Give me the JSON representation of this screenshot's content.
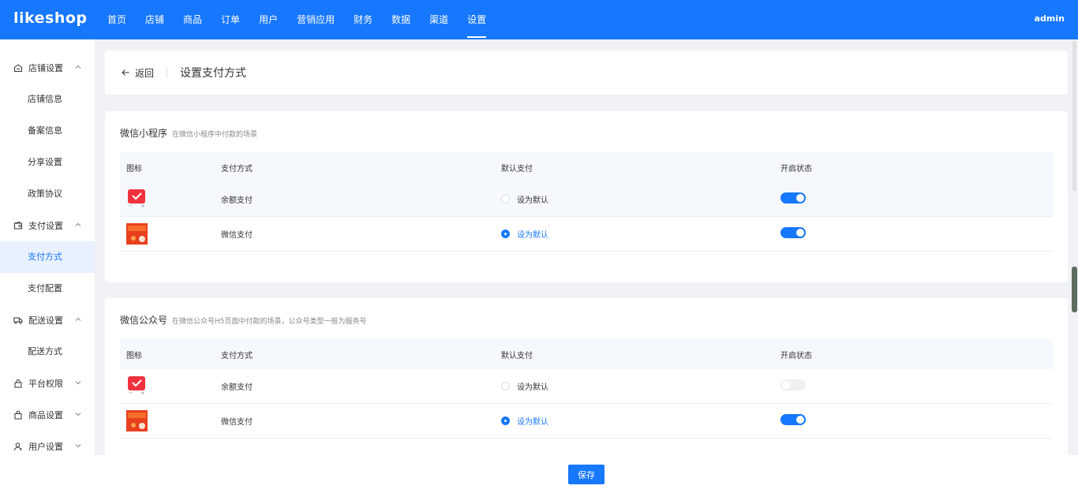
{
  "header": {
    "logo": "likeshop",
    "nav": [
      "首页",
      "店铺",
      "商品",
      "订单",
      "用户",
      "营销应用",
      "财务",
      "数据",
      "渠道",
      "设置"
    ],
    "active_nav": "设置",
    "user": "admin"
  },
  "sidebar": {
    "groups": [
      {
        "label": "店铺设置",
        "icon": "home-icon",
        "expanded": true,
        "items": [
          "店铺信息",
          "备案信息",
          "分享设置",
          "政策协议"
        ]
      },
      {
        "label": "支付设置",
        "icon": "wallet-icon",
        "expanded": true,
        "items": [
          "支付方式",
          "支付配置"
        ]
      },
      {
        "label": "配送设置",
        "icon": "truck-icon",
        "expanded": true,
        "items": [
          "配送方式"
        ]
      },
      {
        "label": "平台权限",
        "icon": "lock-icon",
        "expanded": false,
        "items": []
      },
      {
        "label": "商品设置",
        "icon": "bag-icon",
        "expanded": false,
        "items": []
      },
      {
        "label": "用户设置",
        "icon": "user-icon",
        "expanded": false,
        "items": []
      }
    ],
    "active_item": "支付方式"
  },
  "page": {
    "back_label": "返回",
    "title": "设置支付方式"
  },
  "columns": [
    "图标",
    "支付方式",
    "默认支付",
    "开启状态"
  ],
  "sections": [
    {
      "title": "微信小程序",
      "subtitle": "在微信小程序中付款的场景",
      "rows": [
        {
          "method": "余额支付",
          "default_label": "设为默认",
          "is_default": false,
          "enabled": true,
          "icon": "balance-pay-icon"
        },
        {
          "method": "微信支付",
          "default_label": "设为默认",
          "is_default": true,
          "enabled": true,
          "icon": "wechat-pay-icon"
        }
      ]
    },
    {
      "title": "微信公众号",
      "subtitle": "在微信公众号H5页面中付款的场景，公众号类型一般为服务号",
      "rows": [
        {
          "method": "余额支付",
          "default_label": "设为默认",
          "is_default": false,
          "enabled": false,
          "icon": "balance-pay-icon"
        },
        {
          "method": "微信支付",
          "default_label": "设为默认",
          "is_default": true,
          "enabled": true,
          "icon": "wechat-pay-icon"
        }
      ]
    }
  ],
  "footer": {
    "save_label": "保存"
  },
  "colors": {
    "primary": "#1677ff",
    "bg": "#f0f2f5"
  }
}
